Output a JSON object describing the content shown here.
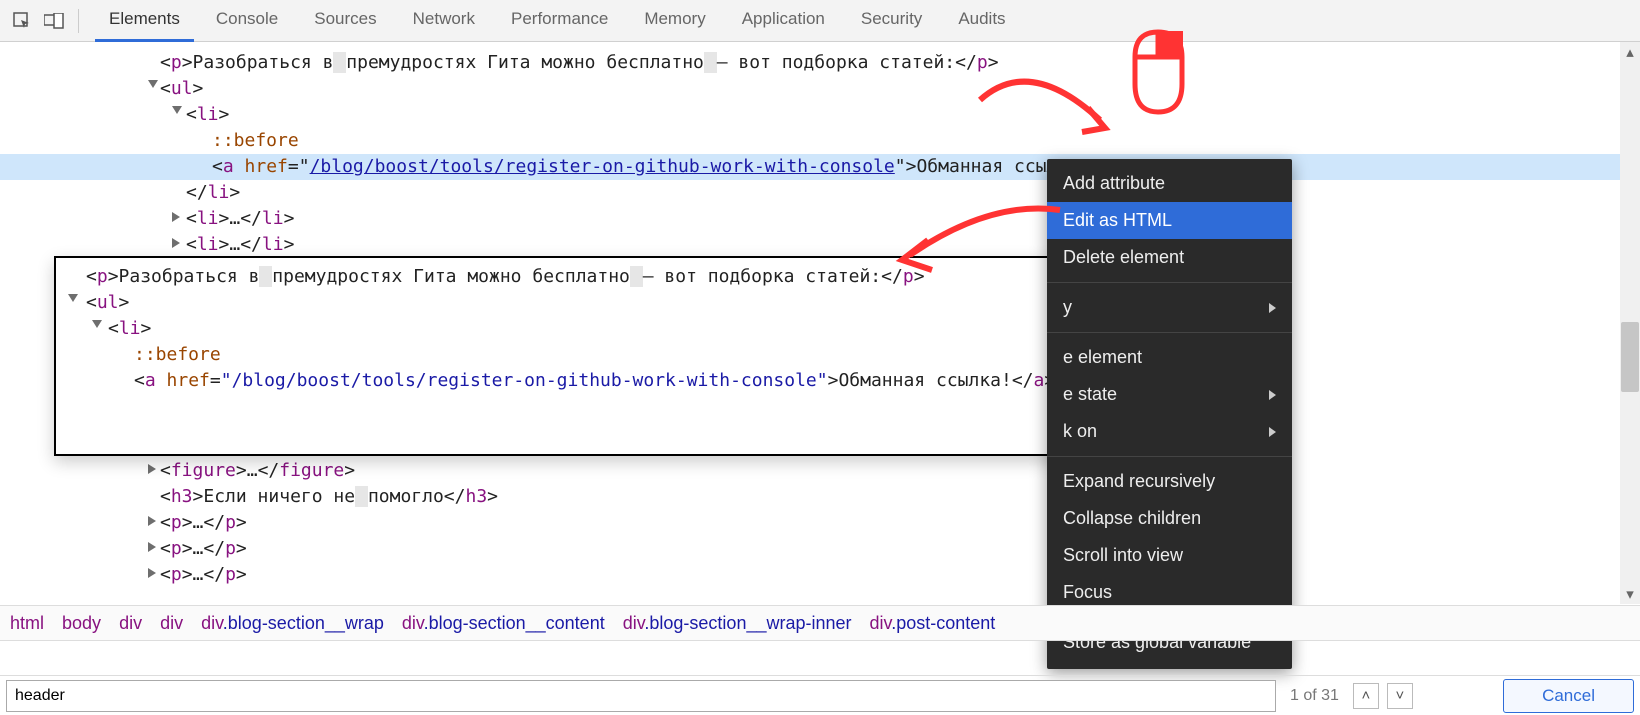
{
  "tabs": [
    {
      "label": "Elements",
      "active": true
    },
    {
      "label": "Console"
    },
    {
      "label": "Sources"
    },
    {
      "label": "Network"
    },
    {
      "label": "Performance"
    },
    {
      "label": "Memory"
    },
    {
      "label": "Application"
    },
    {
      "label": "Security"
    },
    {
      "label": "Audits"
    }
  ],
  "tree": {
    "p1_text_a": "Разобраться в",
    "nbsp": "&nbsp;",
    "p1_text_b": "премудростях Гита можно бесплатно",
    "p1_text_c": "— вот подборка статей:",
    "pseudo": "::before",
    "href": "/blog/boost/tools/register-on-github-work-with-console",
    "link_text": "Обманная ссылка!",
    "figure": "figure",
    "h3_a": "Если ничего не",
    "h3_b": "помогло"
  },
  "edit": {
    "line1_a": "Разобраться в",
    "line1_b": "премудростях Гита можно бесплатно",
    "line1_c": "— вот подборка статей:",
    "href": "/blog/boost/tools/register-on-github-work-with-console",
    "link_text": "Обманная ссылка!"
  },
  "ctx": {
    "add_attr": "Add attribute",
    "edit_html": "Edit as HTML",
    "delete": "Delete element",
    "hide": "e element",
    "force": "e state",
    "break": "k on",
    "expand": "Expand recursively",
    "collapse": "Collapse children",
    "scroll": "Scroll into view",
    "focus": "Focus",
    "store": "Store as global variable"
  },
  "crumbs": [
    {
      "tag": "html"
    },
    {
      "tag": "body"
    },
    {
      "tag": "div"
    },
    {
      "tag": "div"
    },
    {
      "tag": "div",
      "cls": ".blog-section__wrap"
    },
    {
      "tag": "div",
      "cls": ".blog-section__content"
    },
    {
      "tag": "div",
      "cls": ".blog-section__wrap-inner"
    },
    {
      "tag": "div",
      "cls": ".post-content"
    }
  ],
  "find": {
    "value": "header",
    "count": "1 of 31",
    "cancel": "Cancel"
  }
}
